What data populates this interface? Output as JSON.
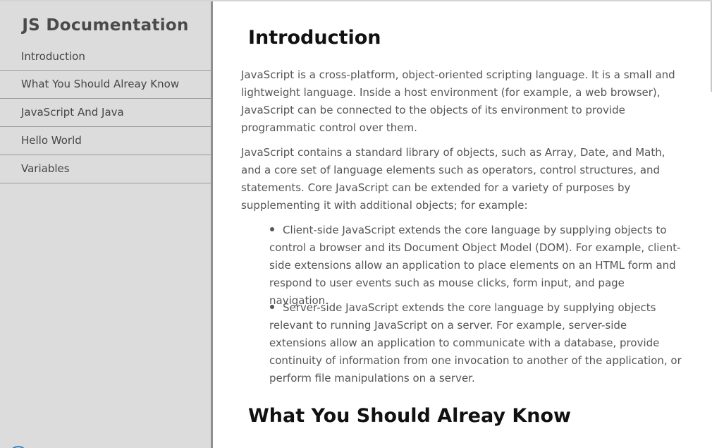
{
  "sidebar": {
    "title": "JS Documentation",
    "items": [
      {
        "label": "Introduction"
      },
      {
        "label": "What You Should Alreay Know"
      },
      {
        "label": "JavaScript And Java"
      },
      {
        "label": "Hello World"
      },
      {
        "label": "Variables"
      }
    ]
  },
  "main": {
    "sections": [
      {
        "title": "Introduction",
        "paragraphs": [
          "JavaScript is a cross-platform, object-oriented scripting language. It is a small and lightweight language. Inside a host environment (for example, a web browser), JavaScript can be connected to the objects of its environment to provide programmatic control over them.",
          "JavaScript contains a standard library of objects, such as Array, Date, and Math, and a core set of language elements such as operators, control structures, and statements. Core JavaScript can be extended for a variety of purposes by supplementing it with additional objects; for example:"
        ],
        "bullets": [
          "Client-side JavaScript extends the core language by supplying objects to control a browser and its Document Object Model (DOM). For example, client-side extensions allow an application to place elements on an HTML form and respond to user events such as mouse clicks, form input, and page navigation.",
          "Server-side JavaScript extends the core language by supplying objects relevant to running JavaScript on a server. For example, server-side extensions allow an application to communicate with a database, provide continuity of information from one invocation to another of the application, or perform file manipulations on a server."
        ]
      },
      {
        "title": "What You Should Alreay Know"
      }
    ]
  },
  "colors": {
    "sidebar_bg": "#dcdcdc",
    "sidebar_divider": "#8f8f8f",
    "text": "#555555",
    "heading": "#111111"
  }
}
